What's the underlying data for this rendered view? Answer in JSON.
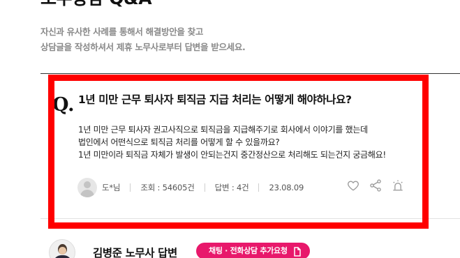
{
  "header": {
    "title": "노무상담 Q&A",
    "intro_line1": "자신과 유사한 사례를 통해서 해결방안을 찾고",
    "intro_line2": "상담글을 작성하셔서 제휴 노무사로부터 답변을 받으세요."
  },
  "question": {
    "mark": "Q.",
    "title": "1년 미만 근무 퇴사자 퇴직금 지급 처리는 어떻게 해야하나요?",
    "body_lines": [
      "1년 미만 근무 퇴사자 권고사직으로 퇴직금을 지급해주기로 회사에서 이야기를 했는데",
      "법인에서 어떤식으로 퇴직금 처리를 어떻게 할 수 있을까요?",
      "1년 미만이라 퇴직금 자체가 발생이 안되는건지 중간정산으로 처리해도 되는건지 궁금해요!"
    ],
    "meta": {
      "author": "도*님",
      "views": "조회 : 54605건",
      "answers": "답변 : 4건",
      "date": "23.08.09"
    },
    "icons": [
      "heart-icon",
      "share-icon",
      "siren-icon"
    ]
  },
  "answer": {
    "name": "김병준 노무사 답변",
    "consult_button": "채팅 · 전화상담 추가요청"
  },
  "colors": {
    "highlight_border": "#ff0000",
    "consult_button": "#e8186b"
  }
}
